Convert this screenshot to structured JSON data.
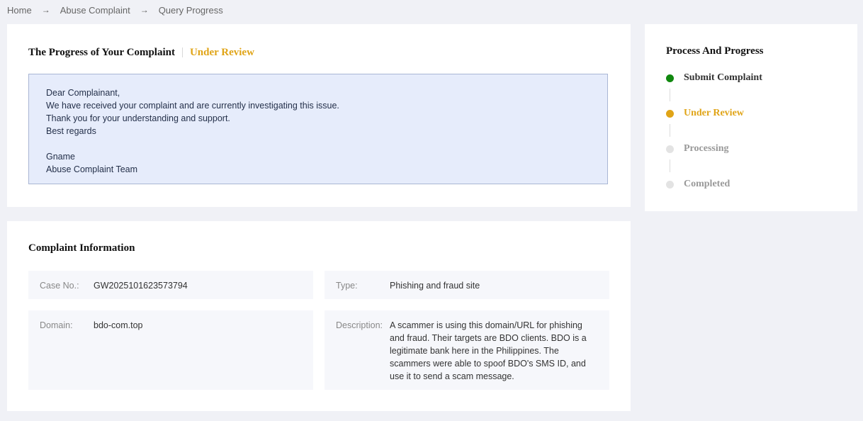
{
  "breadcrumb": {
    "items": [
      "Home",
      "Abuse Complaint",
      "Query Progress"
    ],
    "separator": "→"
  },
  "progress_card": {
    "title": "The Progress of Your Complaint",
    "status": "Under Review",
    "message_lines": [
      "Dear Complainant,",
      "We have received your complaint and are currently investigating this issue.",
      "Thank you for your understanding and support.",
      "Best regards",
      "",
      "Gname",
      "Abuse Complaint Team"
    ]
  },
  "process_card": {
    "title": "Process And Progress",
    "steps": [
      {
        "label": "Submit Complaint",
        "state": "done",
        "dot_color": "#11880f",
        "text_color": "#333333"
      },
      {
        "label": "Under Review",
        "state": "current",
        "dot_color": "#e0a417",
        "text_color": "#e0a417"
      },
      {
        "label": "Processing",
        "state": "pending",
        "dot_color": "#e3e3e3",
        "text_color": "#999999"
      },
      {
        "label": "Completed",
        "state": "pending",
        "dot_color": "#e3e3e3",
        "text_color": "#999999"
      }
    ]
  },
  "info_card": {
    "title": "Complaint Information",
    "case_no_label": "Case No.:",
    "case_no": "GW2025101623573794",
    "type_label": "Type:",
    "type": "Phishing and fraud site",
    "domain_label": "Domain:",
    "domain": "bdo-com.top",
    "description_label": "Description:",
    "description": "A scammer is using this domain/URL for phishing and fraud. Their targets are BDO clients. BDO is a legitimate bank here in the Philippines. The scammers were able to spoof BDO's SMS ID, and use it to send a scam message."
  },
  "colors": {
    "page_bg": "#f0f1f6",
    "accent_orange": "#e0a417",
    "done_green": "#11880f",
    "message_bg": "#e6ecfb"
  }
}
